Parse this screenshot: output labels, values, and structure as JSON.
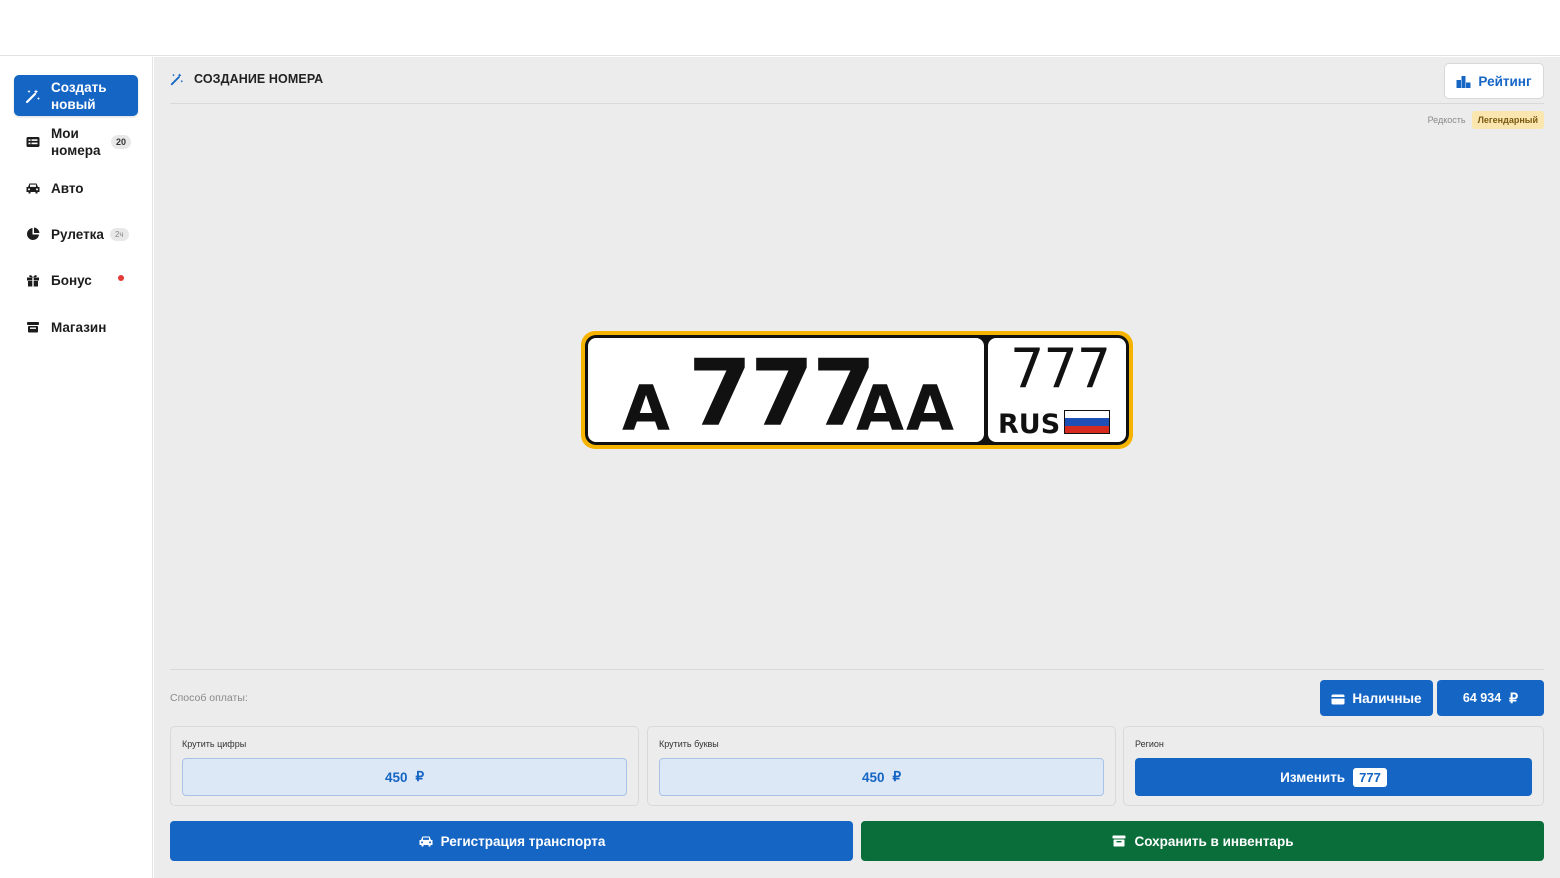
{
  "sidebar": {
    "items": [
      {
        "label": "Создать новый",
        "icon": "magic-wand-icon"
      },
      {
        "label": "Мои номера",
        "icon": "list-card-icon",
        "badge": "20"
      },
      {
        "label": "Авто",
        "icon": "car-icon"
      },
      {
        "label": "Рулетка",
        "icon": "pie-chart-icon",
        "badge": "2ч"
      },
      {
        "label": "Бонус",
        "icon": "gift-icon"
      },
      {
        "label": "Магазин",
        "icon": "store-icon"
      }
    ]
  },
  "header": {
    "title": "СОЗДАНИЕ НОМЕРА",
    "title_icon": "magic-wand-icon",
    "rating_label": "Рейтинг",
    "rating_icon": "podium-icon"
  },
  "rarity": {
    "label": "Редкость",
    "value": "Легендарный",
    "color": "#fbe6b0"
  },
  "plate": {
    "letter1": "А",
    "digits": "777",
    "letters": "АА",
    "region": "777",
    "country": "RUS",
    "frame_color": "#f6b400",
    "flag_colors": [
      "#ffffff",
      "#1e4fb5",
      "#d52b1e"
    ]
  },
  "payment": {
    "label": "Способ оплаты:",
    "method_label": "Наличные",
    "method_icon": "wallet-icon",
    "balance": "64 934",
    "currency": "₽"
  },
  "options": {
    "digits": {
      "label": "Крутить цифры",
      "price": "450",
      "currency": "₽"
    },
    "letters": {
      "label": "Крутить буквы",
      "price": "450",
      "currency": "₽"
    },
    "region": {
      "label": "Регион",
      "button_label": "Изменить",
      "value": "777"
    }
  },
  "actions": {
    "register_label": "Регистрация транспорта",
    "register_icon": "car-icon",
    "save_label": "Сохранить в инвентарь",
    "save_icon": "archive-icon"
  },
  "colors": {
    "accent": "#1565c4",
    "success": "#0a6e3a",
    "background": "#ececec"
  }
}
